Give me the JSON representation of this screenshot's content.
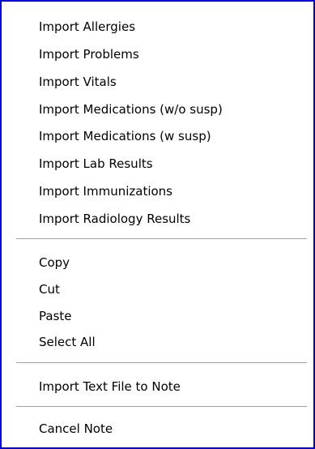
{
  "menu": {
    "items": [
      {
        "label": "Import Allergies"
      },
      {
        "label": "Import Problems"
      },
      {
        "label": "Import Vitals"
      },
      {
        "label": "Import Medications (w/o susp)"
      },
      {
        "label": "Import Medications (w susp)"
      },
      {
        "label": "Import Lab Results"
      },
      {
        "label": "Import Immunizations"
      },
      {
        "label": "Import Radiology Results"
      },
      {
        "label": "Copy"
      },
      {
        "label": "Cut"
      },
      {
        "label": "Paste"
      },
      {
        "label": "Select All"
      },
      {
        "label": "Import Text File to Note"
      },
      {
        "label": "Cancel Note"
      }
    ]
  },
  "colors": {
    "border": "#0000e0",
    "background": "#ffffff",
    "separator": "#a0a0a0"
  }
}
